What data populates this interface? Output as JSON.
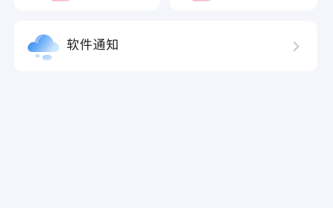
{
  "cards": {
    "software_notification": {
      "label": "软件通知",
      "icon": "cloud-icon",
      "trailing_icon": "chevron-right-icon"
    }
  },
  "colors": {
    "background": "#f5f6fc",
    "card": "#ffffff",
    "text": "#1b1b1f",
    "chevron": "#c4c6cd",
    "cloud_primary": "#3c8cf2",
    "cloud_light": "#a9d3fb",
    "peek_icon_pink": "#f6b9c7"
  }
}
